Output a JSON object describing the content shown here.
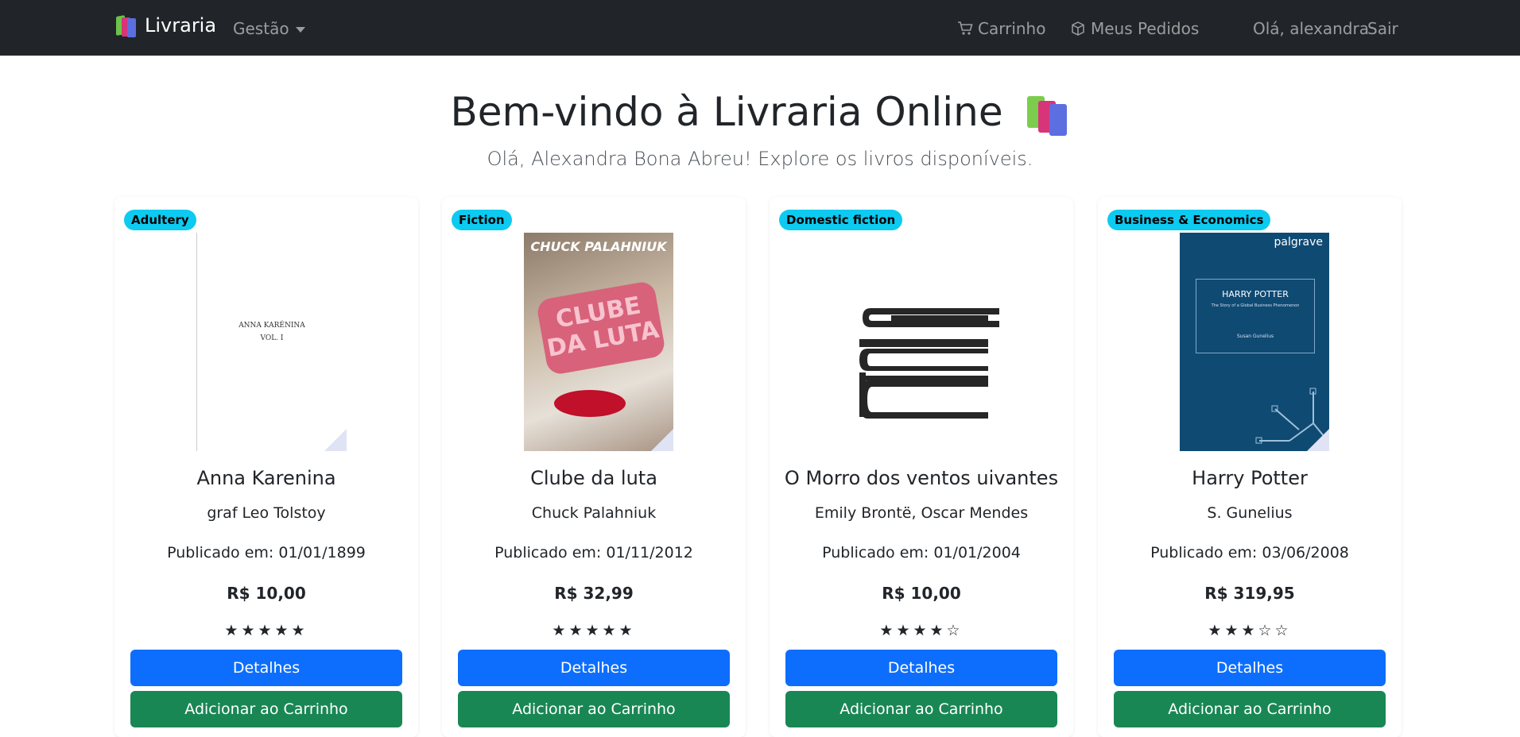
{
  "nav": {
    "brand": "Livraria",
    "management": "Gestão",
    "cart": "Carrinho",
    "orders": "Meus Pedidos",
    "greeting": "Olá, alexandra",
    "logout": "Sair"
  },
  "header": {
    "title": "Bem-vindo à Livraria Online",
    "subtitle": "Olá, Alexandra Bona Abreu! Explore os livros disponíveis."
  },
  "books": [
    {
      "category": "Adultery",
      "title": "Anna Karenina",
      "author": "graf Leo Tolstoy",
      "published": "Publicado em: 01/01/1899",
      "price": "R$ 10,00",
      "rating": 5,
      "stars": "★★★★★",
      "cover_line1": "ANNA KARÉNINA",
      "cover_line2": "VOL. I"
    },
    {
      "category": "Fiction",
      "title": "Clube da luta",
      "author": "Chuck Palahniuk",
      "published": "Publicado em: 01/11/2012",
      "price": "R$ 32,99",
      "rating": 5,
      "stars": "★★★★★",
      "cover_author": "CHUCK PALAHNIUK",
      "cover_title": "CLUBE DA LUTA"
    },
    {
      "category": "Domestic fiction",
      "title": "O Morro dos ventos uivantes",
      "author": "Emily Brontë, Oscar Mendes",
      "published": "Publicado em: 01/01/2004",
      "price": "R$ 10,00",
      "rating": 4,
      "stars": "★★★★☆"
    },
    {
      "category": "Business & Economics",
      "title": "Harry Potter",
      "author": "S. Gunelius",
      "published": "Publicado em: 03/06/2008",
      "price": "R$ 319,95",
      "rating": 3,
      "stars": "★★★☆☆",
      "cover_publisher": "palgrave",
      "cover_title": "HARRY POTTER",
      "cover_subtitle": "The Story of a Global Business Phenomenon",
      "cover_author": "Susan Gunelius"
    }
  ],
  "buttons": {
    "details": "Detalhes",
    "add_to_cart": "Adicionar ao Carrinho"
  }
}
